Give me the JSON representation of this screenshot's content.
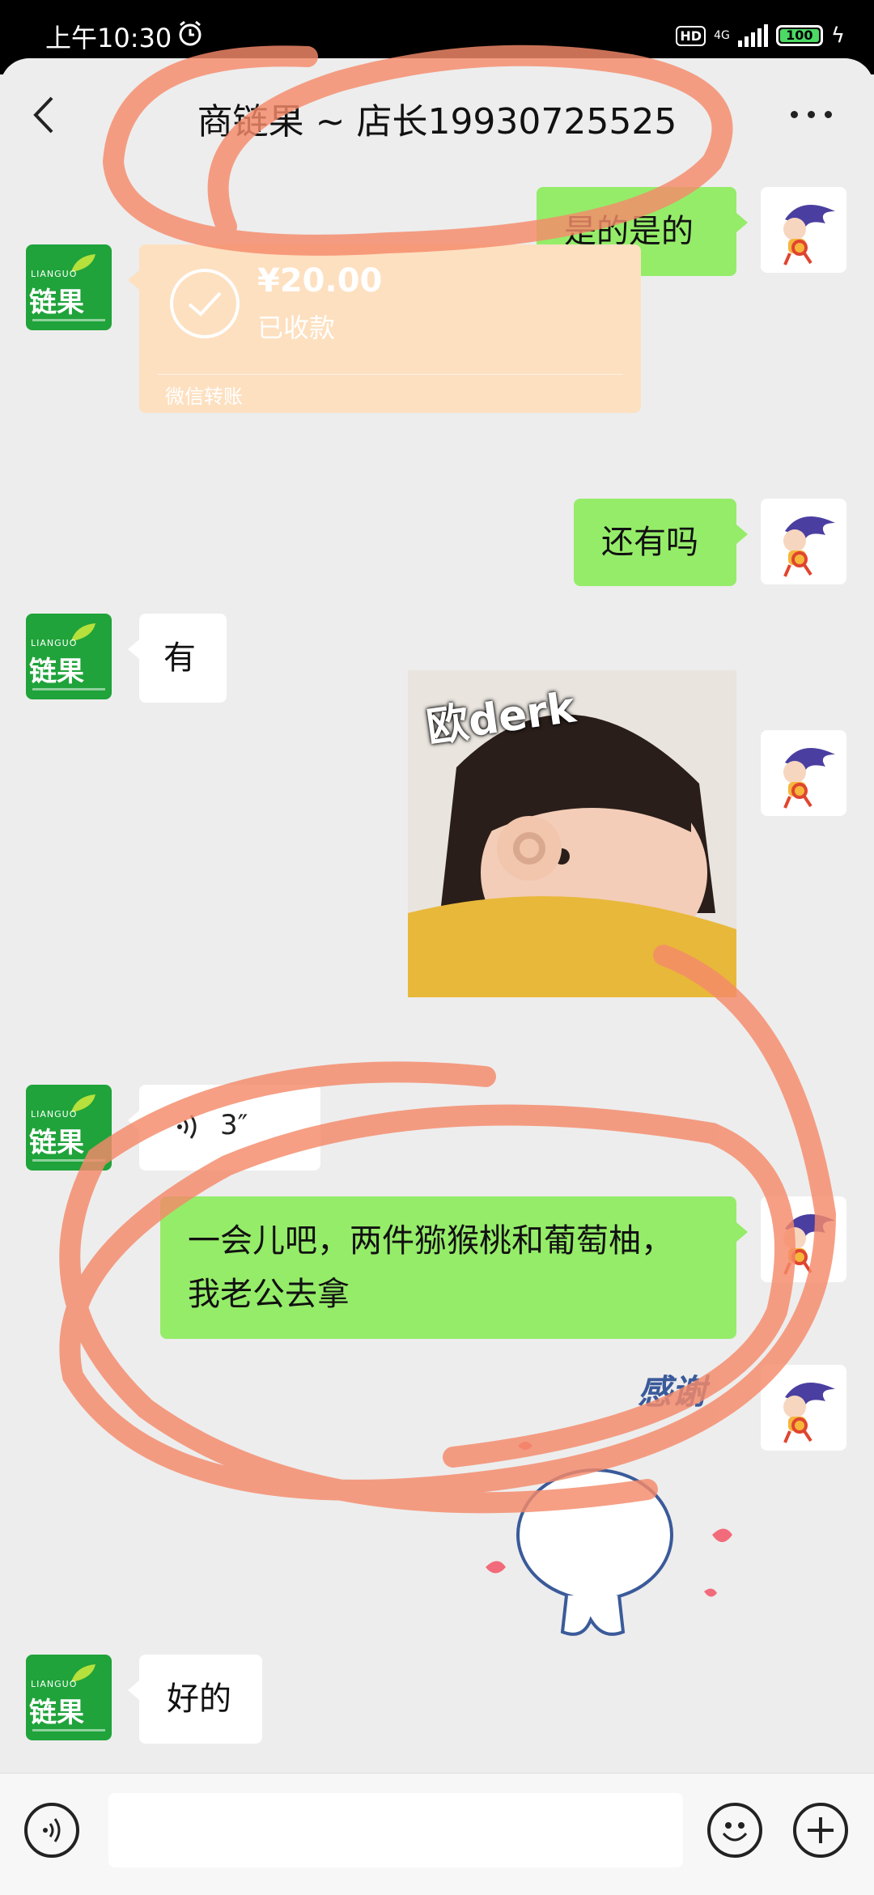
{
  "status_bar": {
    "time": "上午10:30",
    "hd": "HD",
    "network": "4G",
    "battery": "100"
  },
  "header": {
    "title": "商链果 ~ 店长19930725525"
  },
  "messages": {
    "m1": "是的是的",
    "transfer": {
      "amount": "¥20.00",
      "status": "已收款",
      "label": "微信转账"
    },
    "m3": "还有吗",
    "m4": "有",
    "sticker_caption": "欧derk",
    "voice_duration": "3″",
    "m7_line1": "一会儿吧，两件猕猴桃和葡萄柚，",
    "m7_line2": "我老公去拿",
    "thanks_sticker": "感谢",
    "m9": "好的"
  },
  "store_avatar": {
    "pinyin": "LIANGUO",
    "name": "链果"
  },
  "colors": {
    "own_bubble": "#95ec69",
    "other_bubble": "#ffffff",
    "background": "#ededed",
    "annotation": "#f58a6a"
  }
}
